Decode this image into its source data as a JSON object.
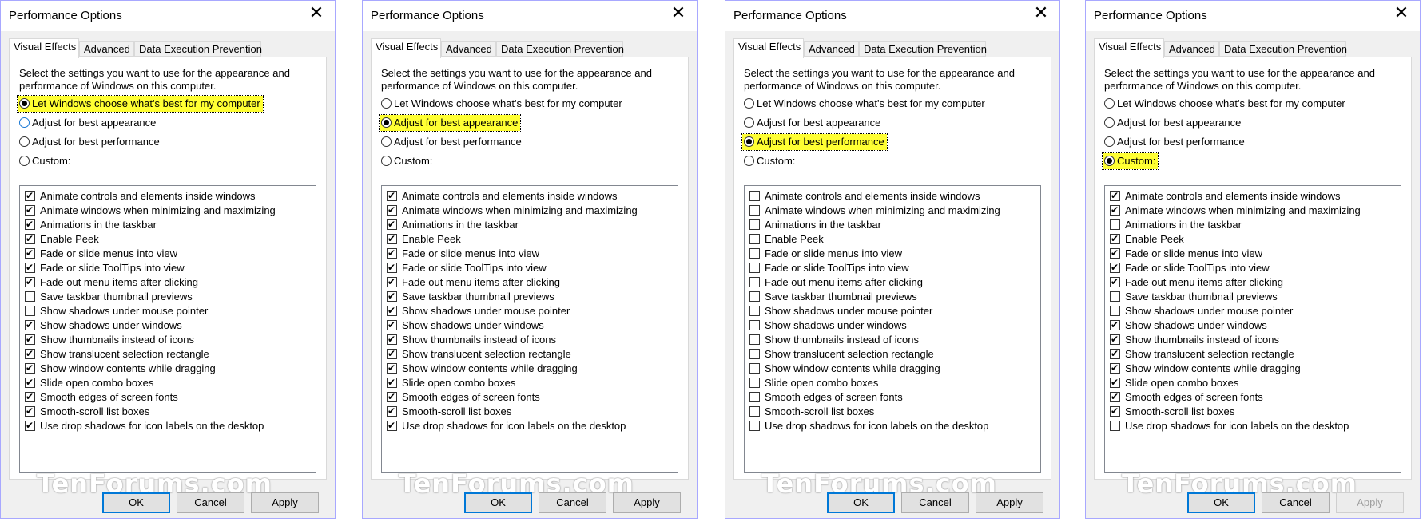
{
  "title": "Performance Options",
  "close_glyph": "✕",
  "tabs": [
    "Visual Effects",
    "Advanced",
    "Data Execution Prevention"
  ],
  "description": "Select the settings you want to use for the appearance and performance of Windows on this computer.",
  "radio_labels": [
    "Let Windows choose what's best for my computer",
    "Adjust for best appearance",
    "Adjust for best performance",
    "Custom:"
  ],
  "checkbox_labels": [
    "Animate controls and elements inside windows",
    "Animate windows when minimizing and maximizing",
    "Animations in the taskbar",
    "Enable Peek",
    "Fade or slide menus into view",
    "Fade or slide ToolTips into view",
    "Fade out menu items after clicking",
    "Save taskbar thumbnail previews",
    "Show shadows under mouse pointer",
    "Show shadows under windows",
    "Show thumbnails instead of icons",
    "Show translucent selection rectangle",
    "Show window contents while dragging",
    "Slide open combo boxes",
    "Smooth edges of screen fonts",
    "Smooth-scroll list boxes",
    "Use drop shadows for icon labels on the desktop"
  ],
  "buttons": {
    "ok": "OK",
    "cancel": "Cancel",
    "apply": "Apply"
  },
  "watermark": "TenForums.com",
  "highlight_color": "#ffff33",
  "dialogs": [
    {
      "selected": 0,
      "apply_enabled": true,
      "checked": [
        true,
        true,
        true,
        true,
        true,
        true,
        true,
        false,
        false,
        true,
        true,
        true,
        true,
        true,
        true,
        true,
        true
      ]
    },
    {
      "selected": 1,
      "apply_enabled": true,
      "checked": [
        true,
        true,
        true,
        true,
        true,
        true,
        true,
        true,
        true,
        true,
        true,
        true,
        true,
        true,
        true,
        true,
        true
      ]
    },
    {
      "selected": 2,
      "apply_enabled": true,
      "checked": [
        false,
        false,
        false,
        false,
        false,
        false,
        false,
        false,
        false,
        false,
        false,
        false,
        false,
        false,
        false,
        false,
        false
      ]
    },
    {
      "selected": 3,
      "apply_enabled": false,
      "checked": [
        true,
        true,
        false,
        true,
        true,
        true,
        true,
        false,
        false,
        true,
        true,
        true,
        true,
        true,
        true,
        true,
        false
      ]
    }
  ]
}
